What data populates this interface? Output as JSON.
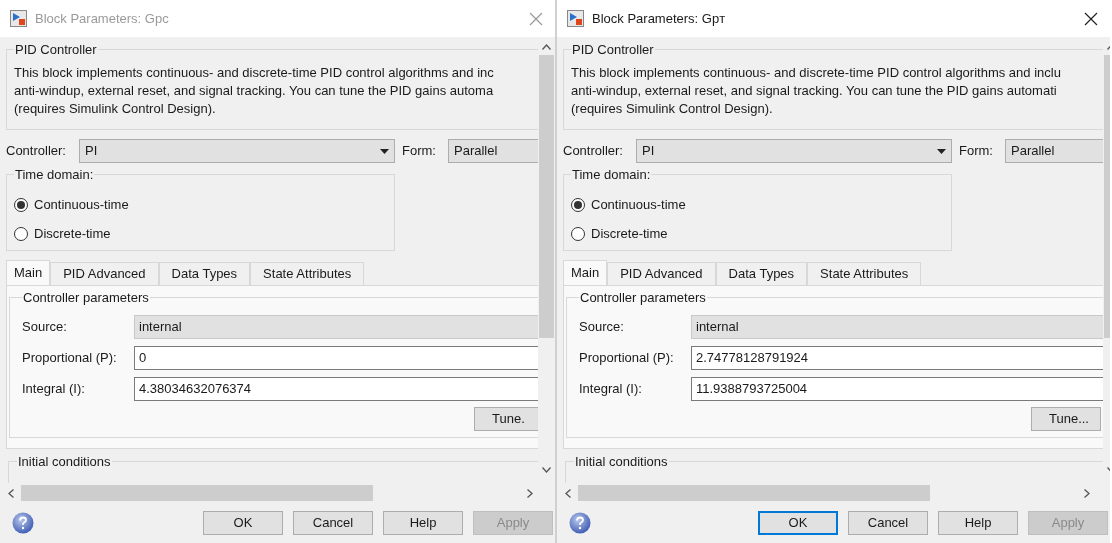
{
  "dialogs": [
    {
      "title": "Block Parameters: Gpc",
      "active": false,
      "block_type": "PID Controller",
      "description": [
        "This block implements continuous- and discrete-time PID control algorithms and inc",
        "anti-windup, external reset, and signal tracking. You can tune the PID gains automa",
        "(requires Simulink Control Design)."
      ],
      "controller": {
        "label": "Controller:",
        "value": "PI"
      },
      "form": {
        "label": "Form:",
        "value": "Parallel"
      },
      "time_domain": {
        "title": "Time domain:",
        "options": [
          {
            "label": "Continuous-time",
            "selected": true
          },
          {
            "label": "Discrete-time",
            "selected": false
          }
        ]
      },
      "tabs": [
        {
          "label": "Main",
          "selected": true
        },
        {
          "label": "PID Advanced",
          "selected": false
        },
        {
          "label": "Data Types",
          "selected": false
        },
        {
          "label": "State Attributes",
          "selected": false
        }
      ],
      "parameters": {
        "title": "Controller parameters",
        "rows": [
          {
            "label": "Source:",
            "value": "internal",
            "disabled": true
          },
          {
            "label": "Proportional (P):",
            "value": "0",
            "disabled": false
          },
          {
            "label": "Integral (I):",
            "value": "4.38034632076374",
            "disabled": false
          }
        ]
      },
      "tune_button": "Tune.",
      "next_section": "Initial conditions",
      "buttons": [
        {
          "label": "OK",
          "default": false,
          "disabled": false
        },
        {
          "label": "Cancel",
          "default": false,
          "disabled": false
        },
        {
          "label": "Help",
          "default": false,
          "disabled": false
        },
        {
          "label": "Apply",
          "default": false,
          "disabled": true
        }
      ]
    },
    {
      "title": "Block Parameters: Gpт",
      "active": true,
      "block_type": "PID Controller",
      "description": [
        "This block implements continuous- and discrete-time PID control algorithms and inclu",
        "anti-windup, external reset, and signal tracking. You can tune the PID gains automati",
        "(requires Simulink Control Design)."
      ],
      "controller": {
        "label": "Controller:",
        "value": "PI"
      },
      "form": {
        "label": "Form:",
        "value": "Parallel"
      },
      "time_domain": {
        "title": "Time domain:",
        "options": [
          {
            "label": "Continuous-time",
            "selected": true
          },
          {
            "label": "Discrete-time",
            "selected": false
          }
        ]
      },
      "tabs": [
        {
          "label": "Main",
          "selected": true
        },
        {
          "label": "PID Advanced",
          "selected": false
        },
        {
          "label": "Data Types",
          "selected": false
        },
        {
          "label": "State Attributes",
          "selected": false
        }
      ],
      "parameters": {
        "title": "Controller parameters",
        "rows": [
          {
            "label": "Source:",
            "value": "internal",
            "disabled": true
          },
          {
            "label": "Proportional (P):",
            "value": "2.74778128791924",
            "disabled": false
          },
          {
            "label": "Integral (I):",
            "value": "11.9388793725004",
            "disabled": false
          }
        ]
      },
      "tune_button": "Tune...",
      "next_section": "Initial conditions",
      "buttons": [
        {
          "label": "OK",
          "default": true,
          "disabled": false
        },
        {
          "label": "Cancel",
          "default": false,
          "disabled": false
        },
        {
          "label": "Help",
          "default": false,
          "disabled": false
        },
        {
          "label": "Apply",
          "default": false,
          "disabled": true
        }
      ]
    }
  ]
}
